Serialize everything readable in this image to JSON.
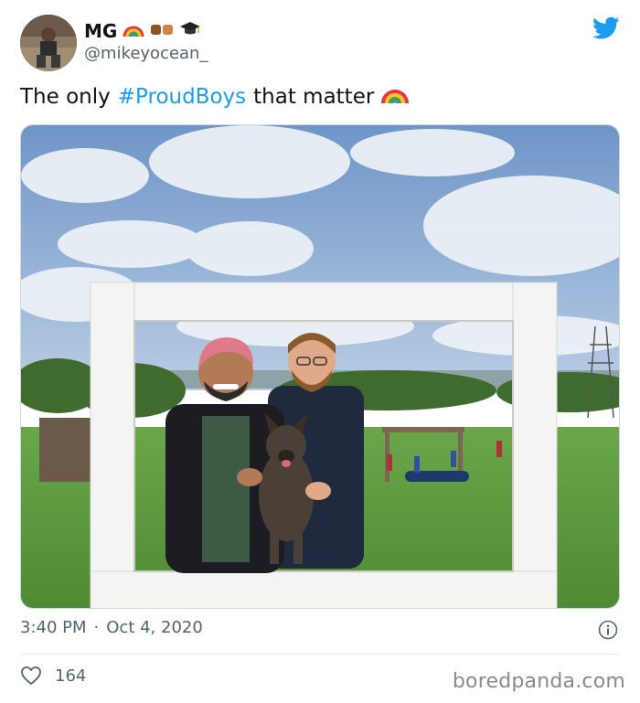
{
  "author": {
    "name": "MG",
    "handle": "@mikeyocean_",
    "name_emojis": [
      "rainbow-icon",
      "fist-bump-icon",
      "graduation-cap-icon"
    ]
  },
  "tweet": {
    "text_before": "The only",
    "hashtag": "#ProudBoys",
    "text_after": "that matter",
    "trailing_emoji": "rainbow-icon"
  },
  "timestamp": {
    "time": "3:40 PM",
    "separator": "·",
    "date": "Oct 4, 2020"
  },
  "engagement": {
    "likes": "164"
  },
  "watermark": "boredpanda.com",
  "colors": {
    "twitter_blue": "#1d9bf0",
    "secondary_text": "#536471",
    "hashtag": "#1d9bf0"
  }
}
